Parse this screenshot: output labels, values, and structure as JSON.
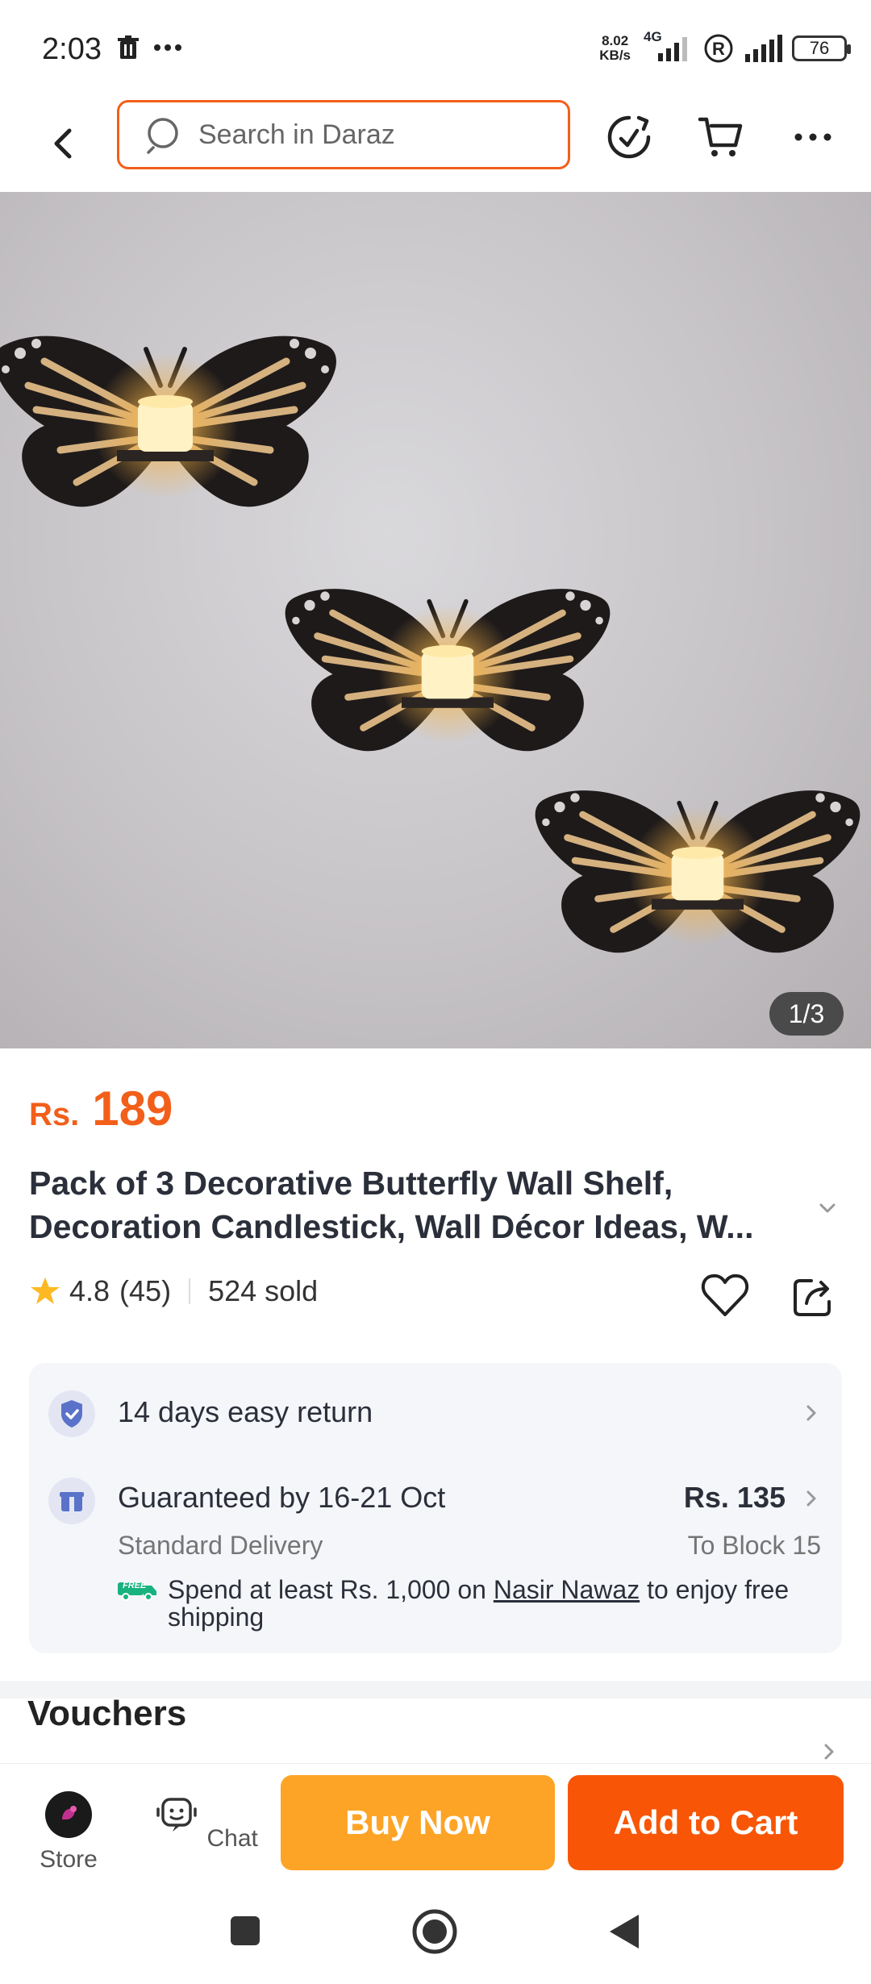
{
  "status_bar": {
    "time": "2:03",
    "net_speed_value": "8.02",
    "net_speed_unit": "KB/s",
    "network": "4G",
    "battery": "76"
  },
  "search": {
    "placeholder": "Search in Daraz"
  },
  "product": {
    "image_indicator": "1/3",
    "price_currency": "Rs.",
    "price": "189",
    "title": "Pack of 3 Decorative Butterfly Wall Shelf, Decoration Candlestick, Wall Décor Ideas, W...",
    "rating": "4.8",
    "rating_count": "(45)",
    "sold": "524 sold"
  },
  "services": {
    "return_label": "14 days easy return",
    "delivery_label": "Guaranteed by 16-21 Oct",
    "delivery_price": "Rs. 135",
    "delivery_type": "Standard Delivery",
    "delivery_location": "To Block 15",
    "free_badge": "FREE",
    "free_shipping_prefix": "Spend at least Rs. 1,000 on ",
    "free_shipping_seller": "Nasir Nawaz",
    "free_shipping_suffix": " to enjoy free shipping"
  },
  "vouchers": {
    "title": "Vouchers"
  },
  "action_bar": {
    "store_label": "Store",
    "chat_label": "Chat",
    "buy_now_label": "Buy Now",
    "add_to_cart_label": "Add to Cart"
  },
  "colors": {
    "brand_orange": "#f85606",
    "buy_now_yellow": "#fda426",
    "price_orange": "#f25f1a"
  }
}
